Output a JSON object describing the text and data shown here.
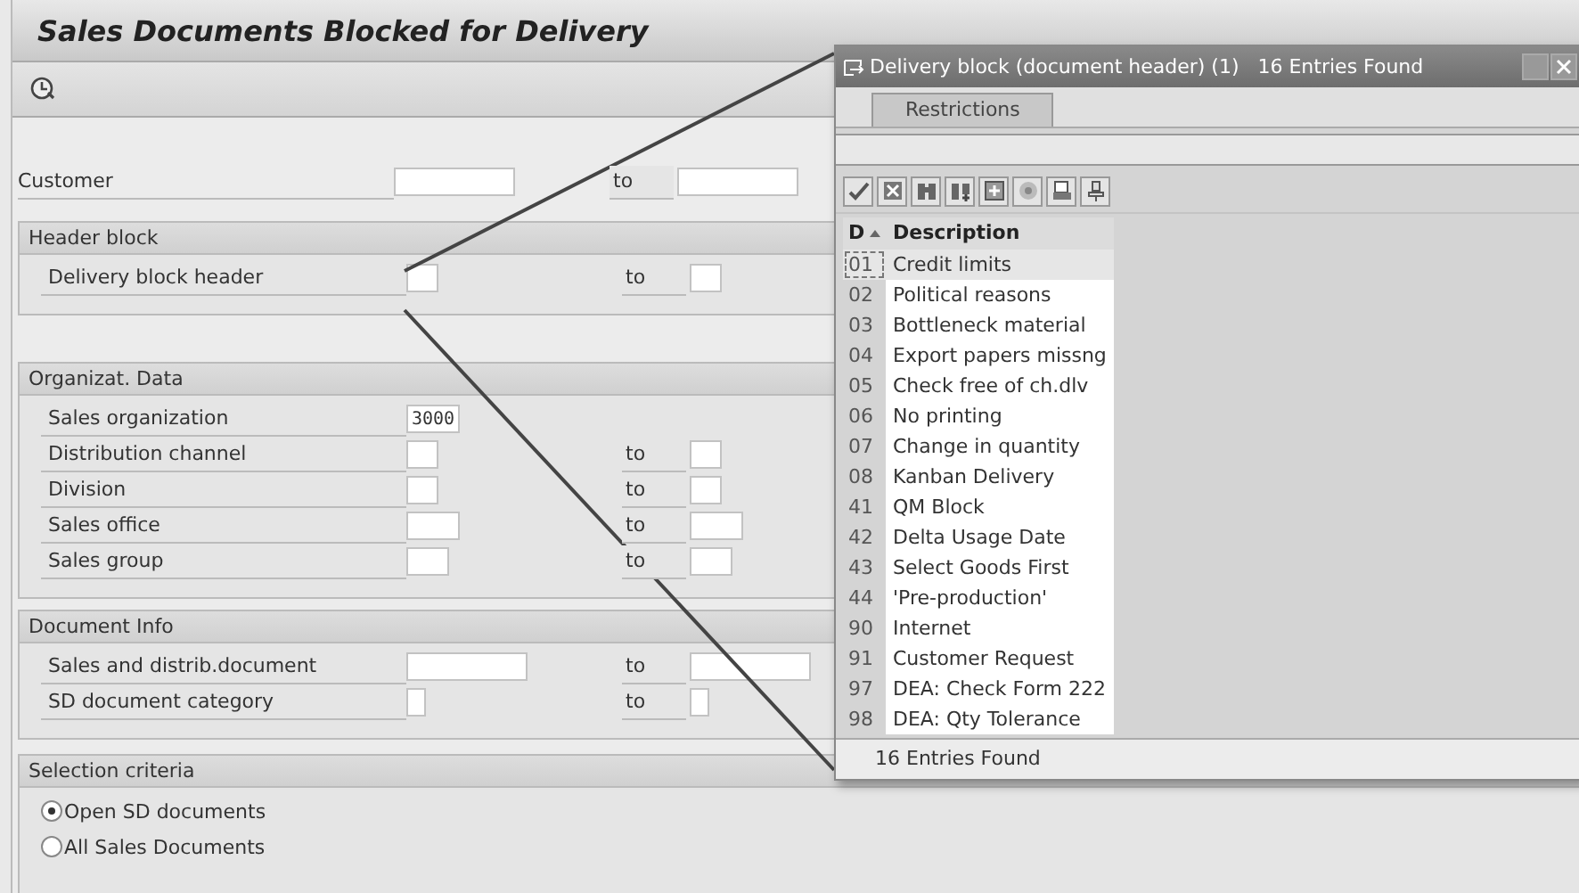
{
  "window": {
    "title": "Sales Documents Blocked for Delivery"
  },
  "toolbar": [
    {
      "kind": "execute"
    }
  ],
  "customer": {
    "label": "Customer",
    "to_label": "to",
    "kind": "wide"
  },
  "groups": [
    {
      "title": "Header block",
      "rows": [
        {
          "label": "Delivery block header",
          "kind": "short",
          "to_label": "to"
        }
      ]
    },
    {
      "title": "Organizat. Data",
      "rows": [
        {
          "label": "Sales organization",
          "kind": "medium",
          "value": "3000"
        },
        {
          "label": "Distribution channel",
          "kind": "short",
          "to_label": "to"
        },
        {
          "label": "Division",
          "kind": "short",
          "to_label": "to"
        },
        {
          "label": "Sales office",
          "kind": "medium",
          "to_label": "to"
        },
        {
          "label": "Sales group",
          "kind": "small",
          "to_label": "to"
        }
      ]
    },
    {
      "title": "Document Info",
      "rows": [
        {
          "label": "Sales and distrib.document",
          "kind": "wide",
          "to_label": "to"
        },
        {
          "label": "SD document category",
          "kind": "tiny",
          "to_label": "to"
        }
      ]
    },
    {
      "title": "Selection criteria",
      "radios": [
        {
          "label": "Open SD documents",
          "selected": true
        },
        {
          "label": "All Sales Documents",
          "selected": false
        }
      ]
    }
  ],
  "popup": {
    "title": "Delivery block (document header) (1)   16 Entries Found",
    "tabs": [
      {
        "label": "Restrictions",
        "selected": true
      }
    ],
    "toolbar": [
      {
        "kind": "check"
      },
      {
        "kind": "cancel"
      },
      {
        "kind": "find"
      },
      {
        "kind": "find-next"
      },
      {
        "kind": "save"
      },
      {
        "kind": "help"
      },
      {
        "kind": "print"
      },
      {
        "kind": "pin"
      }
    ],
    "columns": [
      {
        "label": "D",
        "sorted": true
      },
      {
        "label": "Description",
        "sorted": false
      }
    ],
    "rows": [
      {
        "code": "01",
        "description": "Credit limits",
        "selected": true
      },
      {
        "code": "02",
        "description": "Political reasons",
        "selected": false
      },
      {
        "code": "03",
        "description": "Bottleneck material",
        "selected": false
      },
      {
        "code": "04",
        "description": "Export papers missng",
        "selected": false
      },
      {
        "code": "05",
        "description": "Check free of ch.dlv",
        "selected": false
      },
      {
        "code": "06",
        "description": "No printing",
        "selected": false
      },
      {
        "code": "07",
        "description": "Change in quantity",
        "selected": false
      },
      {
        "code": "08",
        "description": "Kanban Delivery",
        "selected": false
      },
      {
        "code": "41",
        "description": "QM Block",
        "selected": false
      },
      {
        "code": "42",
        "description": "Delta Usage Date",
        "selected": false
      },
      {
        "code": "43",
        "description": "Select Goods First",
        "selected": false
      },
      {
        "code": "44",
        "description": "'Pre-production'",
        "selected": false
      },
      {
        "code": "90",
        "description": "Internet",
        "selected": false
      },
      {
        "code": "91",
        "description": "Customer Request",
        "selected": false
      },
      {
        "code": "97",
        "description": "DEA: Check Form 222",
        "selected": false
      },
      {
        "code": "98",
        "description": "DEA: Qty Tolerance",
        "selected": false
      }
    ],
    "status": "16 Entries Found"
  }
}
